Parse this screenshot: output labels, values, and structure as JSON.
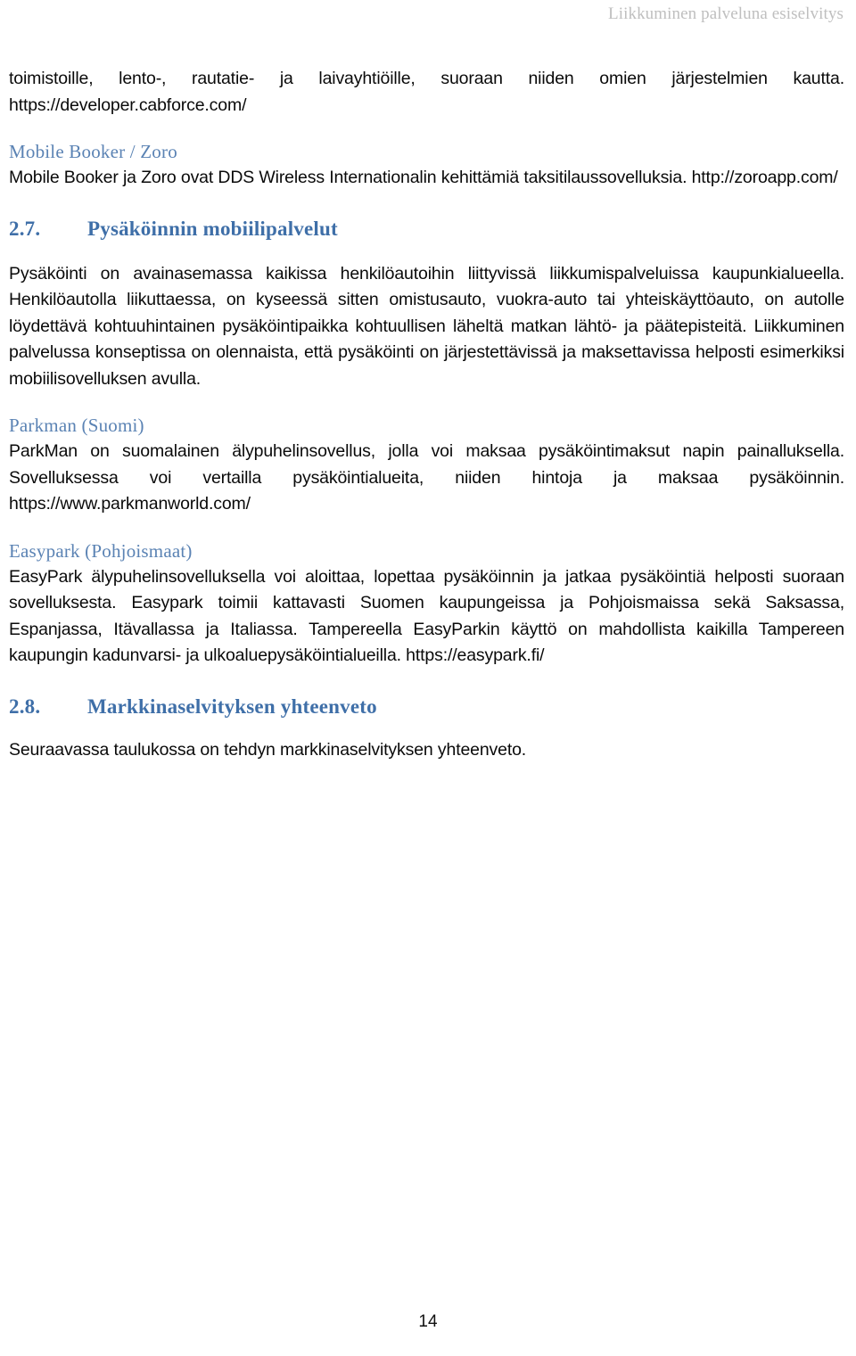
{
  "header": {
    "running_title": "Liikkuminen palveluna esiselvitys"
  },
  "content": {
    "continued_paragraph": "toimistoille, lento-, rautatie- ja laivayhtiöille, suoraan niiden omien järjestelmien kautta. https://developer.cabforce.com/",
    "mobile_booker": {
      "heading": "Mobile Booker / Zoro",
      "paragraph": "Mobile Booker ja Zoro ovat DDS Wireless Internationalin kehittämiä taksitilaussovelluksia. http://zoroapp.com/"
    },
    "section_2_7": {
      "number": "2.7.",
      "title": "Pysäköinnin mobiilipalvelut",
      "paragraph": "Pysäköinti on avainasemassa kaikissa henkilöautoihin liittyvissä liikkumispalveluissa kaupunkialueella. Henkilöautolla liikuttaessa, on kyseessä sitten omistusauto, vuokra-auto tai yhteiskäyttöauto, on autolle löydettävä kohtuuhintainen pysäköintipaikka kohtuullisen läheltä matkan lähtö- ja päätepisteitä. Liikkuminen palvelussa konseptissa on olennaista, että pysäköinti on järjestettävissä ja maksettavissa helposti esimerkiksi mobiilisovelluksen avulla."
    },
    "parkman": {
      "heading": "Parkman (Suomi)",
      "paragraph": "ParkMan on suomalainen älypuhelinsovellus, jolla voi maksaa pysäköintimaksut napin painalluksella. Sovelluksessa voi vertailla pysäköintialueita, niiden hintoja ja maksaa pysäköinnin. https://www.parkmanworld.com/"
    },
    "easypark": {
      "heading": "Easypark (Pohjoismaat)",
      "paragraph": "EasyPark älypuhelinsovelluksella voi aloittaa, lopettaa pysäköinnin ja jatkaa pysäköintiä helposti suoraan sovelluksesta. Easypark toimii kattavasti Suomen kaupungeissa ja Pohjoismaissa sekä Saksassa, Espanjassa, Itävallassa ja Italiassa. Tampereella EasyParkin käyttö on mahdollista kaikilla Tampereen kaupungin kadunvarsi- ja ulkoaluepysäköintialueilla. https://easypark.fi/"
    },
    "section_2_8": {
      "number": "2.8.",
      "title": "Markkinaselvityksen yhteenveto",
      "paragraph": "Seuraavassa taulukossa on tehdyn markkinaselvityksen yhteenveto."
    }
  },
  "footer": {
    "page_number": "14"
  },
  "colors": {
    "running_header": "#bfbfbf",
    "section_heading": "#3f6fa8",
    "subheading": "#5b83b4",
    "body_text": "#0a0a0a",
    "page_background": "#ffffff"
  }
}
